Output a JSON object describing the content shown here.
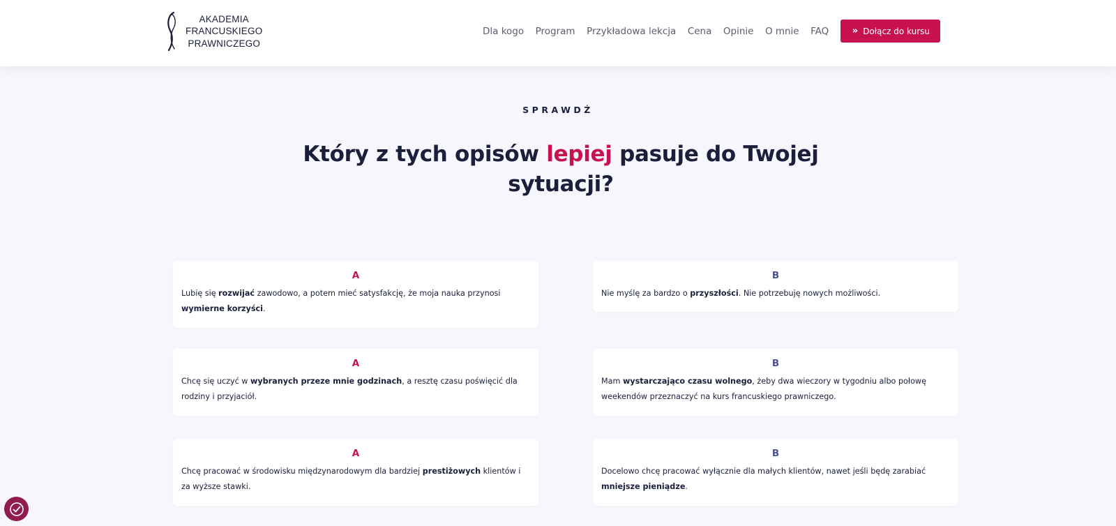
{
  "brand": {
    "lines": [
      "AKADEMIA",
      "FRANCUSKIEGO",
      "PRAWNICZEGO"
    ],
    "accent": "#c8124f",
    "navy": "#1b1f3b",
    "b_color": "#4b5190"
  },
  "nav": {
    "items": [
      "Dla kogo",
      "Program",
      "Przykładowa lekcja",
      "Cena",
      "Opinie",
      "O mnie",
      "FAQ"
    ],
    "cta": "Dołącz do kursu",
    "cta_icon": "chevron-double-right-icon"
  },
  "section": {
    "eyebrow": "SPRAWDŹ",
    "title_before": "Który z tych opisów ",
    "title_highlight": "lepiej",
    "title_after": " pasuje do Twojej sytuacji?"
  },
  "cards": [
    {
      "letter": "A",
      "segments": [
        [
          "Lubię się ",
          false
        ],
        [
          "rozwijać",
          true
        ],
        [
          " zawodowo, a potem mieć satysfakcję, że moja nauka przynosi ",
          false
        ],
        [
          "wymierne korzyści",
          true
        ],
        [
          ".",
          false
        ]
      ]
    },
    {
      "letter": "B",
      "segments": [
        [
          "Nie myślę za bardzo o ",
          false
        ],
        [
          "przyszłości",
          true
        ],
        [
          ". Nie potrzebuję nowych możliwości.",
          false
        ]
      ]
    },
    {
      "letter": "A",
      "segments": [
        [
          "Chcę się uczyć w ",
          false
        ],
        [
          "wybranych przeze mnie godzinach",
          true
        ],
        [
          ", a resztę czasu poświęcić dla rodziny i przyjaciół.",
          false
        ]
      ]
    },
    {
      "letter": "B",
      "segments": [
        [
          "Mam ",
          false
        ],
        [
          "wystarczająco czasu wolnego",
          true
        ],
        [
          ", żeby dwa wieczory w tygodniu albo połowę weekendów przeznaczyć na kurs francuskiego prawniczego.",
          false
        ]
      ]
    },
    {
      "letter": "A",
      "segments": [
        [
          "Chcę pracować w środowisku międzynarodowym dla bardziej ",
          false
        ],
        [
          "prestiżowych",
          true
        ],
        [
          " klientów i za wyższe stawki.",
          false
        ]
      ]
    },
    {
      "letter": "B",
      "segments": [
        [
          "Docelowo chcę pracować wyłącznie dla małych klientów, nawet jeśli będę zarabiać ",
          false
        ],
        [
          "mniejsze pieniądze",
          true
        ],
        [
          ".",
          false
        ]
      ]
    }
  ],
  "cookie_icon": "cookie-consent-icon"
}
